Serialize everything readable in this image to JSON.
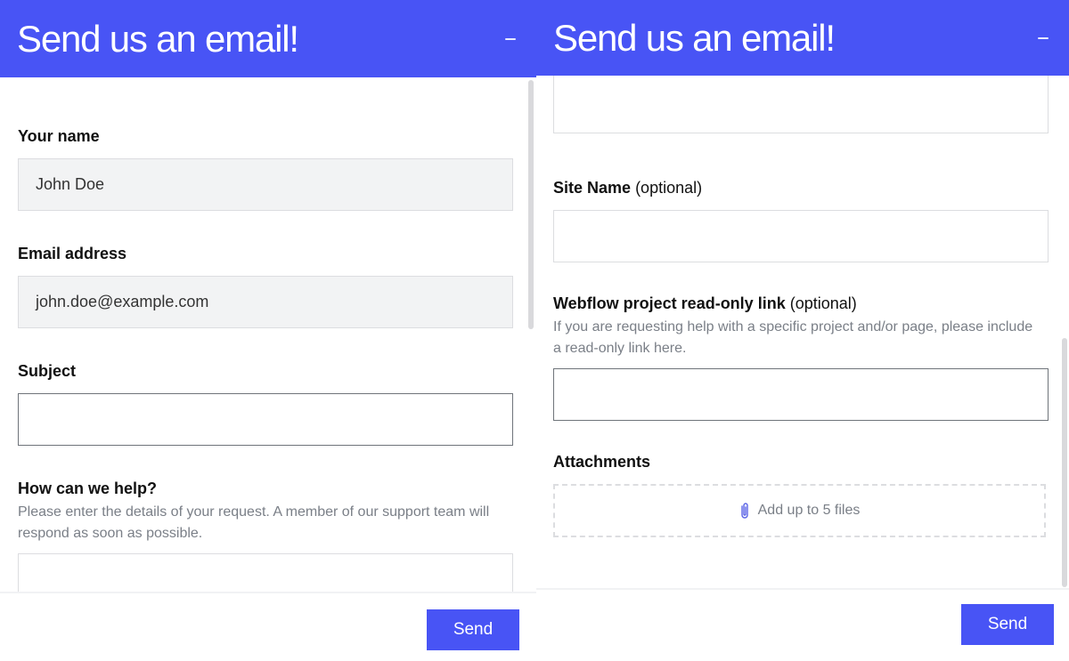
{
  "theme": {
    "accent": "#4854f5"
  },
  "panels": [
    {
      "header": {
        "title": "Send us an email!",
        "minimize_icon": "minimize-icon"
      },
      "fields": {
        "name": {
          "label": "Your name",
          "value": "John Doe"
        },
        "email": {
          "label": "Email address",
          "value": "john.doe@example.com"
        },
        "subject": {
          "label": "Subject",
          "value": ""
        },
        "help": {
          "label": "How can we help?",
          "hint": "Please enter the details of your request. A member of our support team will respond as soon as possible.",
          "value": ""
        }
      },
      "footer": {
        "send_label": "Send"
      }
    },
    {
      "header": {
        "title": "Send us an email!",
        "minimize_icon": "minimize-icon"
      },
      "fields": {
        "site_name": {
          "label": "Site Name",
          "optional": "(optional)",
          "value": ""
        },
        "webflow_link": {
          "label": "Webflow project read-only link",
          "optional": "(optional)",
          "hint": "If you are requesting help with a specific project and/or page, please include a read-only link here.",
          "value": ""
        },
        "attachments": {
          "label": "Attachments",
          "dropzone_text": "Add up to 5 files",
          "icon": "paperclip-icon"
        }
      },
      "footer": {
        "send_label": "Send"
      }
    }
  ]
}
